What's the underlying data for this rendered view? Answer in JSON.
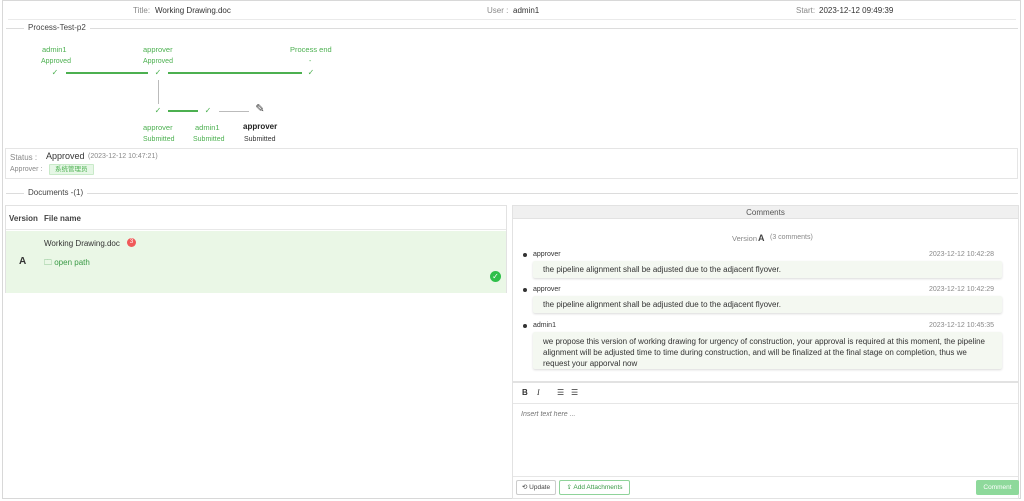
{
  "header": {
    "title_label": "Title:",
    "title_value": "Working Drawing.doc",
    "user_label": "User :",
    "user_value": "admin1",
    "start_label": "Start:",
    "start_value": "2023-12-12 09:49:39"
  },
  "process": {
    "legend": "Process-Test-p2",
    "nodes": [
      {
        "name": "admin1",
        "status": "Approved"
      },
      {
        "name": "approver",
        "status": "Approved"
      },
      {
        "name": "Process end",
        "status": "-"
      },
      {
        "name": "approver",
        "status": "Submitted"
      },
      {
        "name": "admin1",
        "status": "Submitted"
      },
      {
        "name": "approver",
        "status": "Submitted"
      }
    ]
  },
  "status": {
    "label": "Status :",
    "value": "Approved",
    "timestamp": "(2023-12-12 10:47:21)",
    "approver_label": "Approver :",
    "approver_badge": "系统管理员"
  },
  "documents": {
    "legend": "Documents -(1)",
    "col_version": "Version",
    "col_filename": "File name",
    "rows": [
      {
        "version": "A",
        "filename": "Working Drawing.doc",
        "badge": "3",
        "path_label": "open path"
      }
    ]
  },
  "comments": {
    "header": "Comments",
    "version_prefix": "Version",
    "version_letter": "A",
    "count_label": "(3 comments)",
    "items": [
      {
        "author": "approver",
        "time": "2023-12-12 10:42:28",
        "text": "the pipeline alignment shall be adjusted due to the adjacent flyover."
      },
      {
        "author": "approver",
        "time": "2023-12-12 10:42:29",
        "text": "the pipeline alignment shall be adjusted due to the adjacent flyover."
      },
      {
        "author": "admin1",
        "time": "2023-12-12 10:45:35",
        "text": "we propose this version of working drawing for urgency of construction, your approval is required at this moment, the pipeline alignment will be adjusted time to time during construction, and will be finalized at the final stage on completion, thus we request your apporval now"
      }
    ]
  },
  "editor": {
    "bold": "B",
    "italic": "I",
    "placeholder": "Insert text here ...",
    "update_label": "Update",
    "attach_label": "Add Attachments",
    "comment_label": "Comment"
  }
}
